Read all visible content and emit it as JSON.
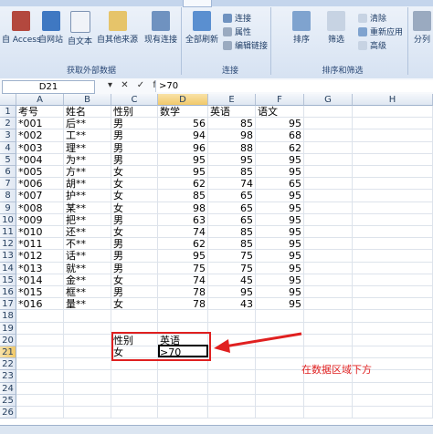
{
  "ribbon": {
    "get_external": [
      {
        "name": "from-access-button",
        "label": "自 Access"
      },
      {
        "name": "from-web-button",
        "label": "自网站"
      },
      {
        "name": "from-text-button",
        "label": "自文本"
      },
      {
        "name": "from-other-button",
        "label": "自其他来源"
      },
      {
        "name": "existing-connection-button",
        "label": "现有连接"
      }
    ],
    "refresh_label": "全部刷新",
    "connections": [
      "连接",
      "属性",
      "编辑链接"
    ],
    "sort_label": "排序",
    "filter_label": "筛选",
    "filter_small": [
      "清除",
      "重新应用",
      "高级"
    ],
    "split_label": "分列",
    "group_labels": [
      "获取外部数据",
      "连接",
      "排序和筛选"
    ]
  },
  "formula_bar": {
    "name_box": "D21",
    "fx_icons": "▾ ✕ ✓ fx",
    "formula": ">70"
  },
  "columns": [
    "A",
    "B",
    "C",
    "D",
    "E",
    "F",
    "G",
    "H"
  ],
  "selected_column": "D",
  "selected_row": 21,
  "header_row": [
    "考号",
    "姓名",
    "性别",
    "数学",
    "英语",
    "语文"
  ],
  "rows": [
    [
      "*001",
      "后**",
      "男",
      "56",
      "85",
      "95"
    ],
    [
      "*002",
      "工**",
      "男",
      "94",
      "98",
      "68"
    ],
    [
      "*003",
      "理**",
      "男",
      "96",
      "88",
      "62"
    ],
    [
      "*004",
      "为**",
      "男",
      "95",
      "95",
      "95"
    ],
    [
      "*005",
      "方**",
      "女",
      "95",
      "85",
      "95"
    ],
    [
      "*006",
      "胡**",
      "女",
      "62",
      "74",
      "65"
    ],
    [
      "*007",
      "护**",
      "女",
      "85",
      "65",
      "95"
    ],
    [
      "*008",
      "某**",
      "女",
      "98",
      "65",
      "95"
    ],
    [
      "*009",
      "把**",
      "男",
      "63",
      "65",
      "95"
    ],
    [
      "*010",
      "还**",
      "女",
      "74",
      "85",
      "95"
    ],
    [
      "*011",
      "不**",
      "男",
      "62",
      "85",
      "95"
    ],
    [
      "*012",
      "话**",
      "男",
      "95",
      "75",
      "95"
    ],
    [
      "*013",
      "就**",
      "男",
      "75",
      "75",
      "95"
    ],
    [
      "*014",
      "金**",
      "女",
      "74",
      "45",
      "95"
    ],
    [
      "*015",
      "框**",
      "男",
      "78",
      "95",
      "95"
    ],
    [
      "*016",
      "量**",
      "女",
      "78",
      "43",
      "95"
    ]
  ],
  "criteria": {
    "header": [
      "性别",
      "英语"
    ],
    "values": [
      "女",
      ">70"
    ]
  },
  "annotation": {
    "text": "在数据区域下方",
    "color": "#e02020"
  },
  "row_numbers": [
    "1",
    "2",
    "3",
    "4",
    "5",
    "6",
    "7",
    "8",
    "9",
    "10",
    "11",
    "12",
    "13",
    "14",
    "15",
    "16",
    "17",
    "18",
    "19",
    "20",
    "21",
    "22",
    "23",
    "24",
    "25",
    "26"
  ]
}
